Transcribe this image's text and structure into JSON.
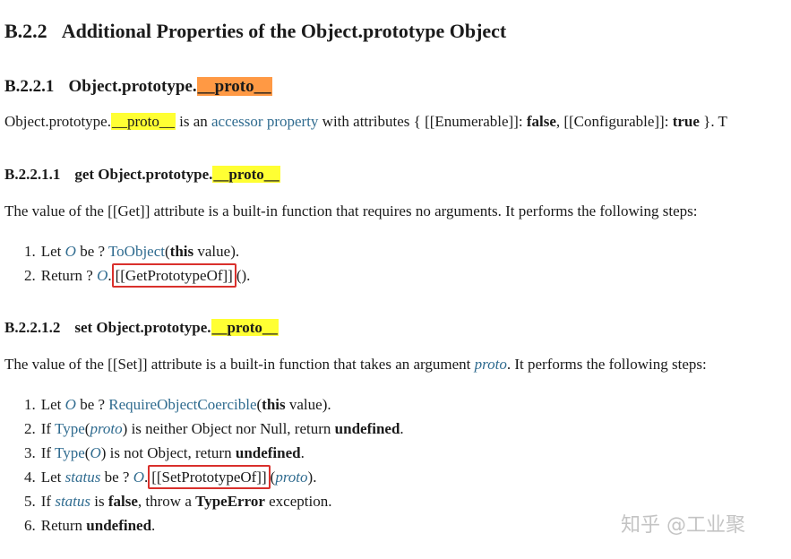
{
  "section": {
    "number": "B.2.2",
    "title": "Additional Properties of the Object.prototype Object"
  },
  "subsection": {
    "number": "B.2.2.1",
    "title_prefix": "Object.prototype.",
    "title_highlight": "__proto__"
  },
  "intro": {
    "t1": "Object.prototype.",
    "t1_hl": "__proto__",
    "t2": " is an ",
    "link": "accessor property",
    "t3": " with attributes { [[Enumerable]]: ",
    "v1": "false",
    "t4": ", [[Configurable]]: ",
    "v2": "true",
    "t5": " }. T"
  },
  "getter": {
    "number": "B.2.2.1.1",
    "title_prefix": "get Object.prototype.",
    "title_highlight": "__proto__",
    "description": "The value of the [[Get]] attribute is a built-in function that requires no arguments. It performs the following steps:",
    "steps": {
      "s1": {
        "num": "1.",
        "t1": "Let ",
        "var": "O",
        "t2": " be ? ",
        "fn": "ToObject",
        "t3": "(",
        "kw": "this",
        "t4": " value)."
      },
      "s2": {
        "num": "2.",
        "t1": "Return ? ",
        "var": "O",
        "t2": ".",
        "boxed": "[[GetPrototypeOf]]",
        "t3": "()."
      }
    }
  },
  "setter": {
    "number": "B.2.2.1.2",
    "title_prefix": "set Object.prototype.",
    "title_highlight": "__proto__",
    "desc_pre": "The value of the [[Set]] attribute is a built-in function that takes an argument ",
    "desc_var": "proto",
    "desc_post": ". It performs the following steps:",
    "steps": {
      "s1": {
        "num": "1.",
        "t1": "Let ",
        "var": "O",
        "t2": " be ? ",
        "fn": "RequireObjectCoercible",
        "t3": "(",
        "kw": "this",
        "t4": " value)."
      },
      "s2": {
        "num": "2.",
        "t1": "If ",
        "fn": "Type",
        "t2": "(",
        "var": "proto",
        "t3": ") is neither Object nor Null, return ",
        "kw": "undefined",
        "t4": "."
      },
      "s3": {
        "num": "3.",
        "t1": "If ",
        "fn": "Type",
        "t2": "(",
        "var": "O",
        "t3": ") is not Object, return ",
        "kw": "undefined",
        "t4": "."
      },
      "s4": {
        "num": "4.",
        "t1": "Let ",
        "var": "status",
        "t2": " be ? ",
        "var2": "O",
        "t3": ".",
        "boxed": "[[SetPrototypeOf]]",
        "t4": "(",
        "var3": "proto",
        "t5": ")."
      },
      "s5": {
        "num": "5.",
        "t1": "If ",
        "var": "status",
        "t2": " is ",
        "kw": "false",
        "t3": ", throw a ",
        "kw2": "TypeError",
        "t4": " exception."
      },
      "s6": {
        "num": "6.",
        "t1": "Return ",
        "kw": "undefined",
        "t2": "."
      }
    }
  },
  "watermark": "知乎 @工业聚",
  "colors": {
    "highlight_yellow": "#ffff33",
    "highlight_orange": "#ff9944",
    "link_blue": "#2f6b8f",
    "box_red": "#d9302c"
  }
}
